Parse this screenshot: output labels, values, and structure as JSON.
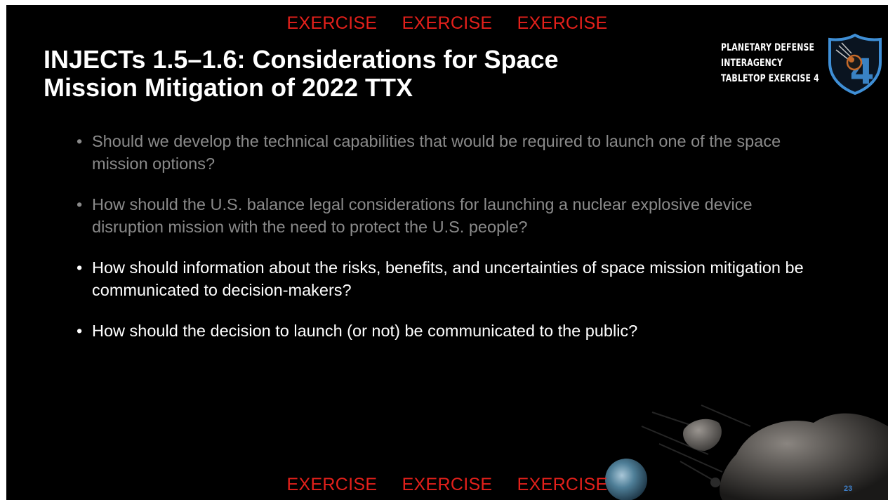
{
  "banner": {
    "words": [
      "EXERCISE",
      "EXERCISE",
      "EXERCISE"
    ]
  },
  "title": {
    "line1": "INJECTs 1.5–1.6: Considerations for Space",
    "line2": "Mission Mitigation of 2022 TTX"
  },
  "logo": {
    "lines": [
      "PLANETARY DEFENSE",
      "INTERAGENCY",
      "TABLETOP EXERCISE 4"
    ],
    "badge_number": "4"
  },
  "bullets": [
    {
      "text": "Should we develop the technical capabilities that would be required to launch one of the space mission options?",
      "state": "dim"
    },
    {
      "text": "How should the U.S. balance legal considerations for launching a nuclear explosive device disruption mission with the need to protect the U.S. people?",
      "state": "dim"
    },
    {
      "text": "How should information about the risks, benefits, and uncertainties of space mission mitigation be communicated to decision-makers?",
      "state": "bright"
    },
    {
      "text": "How should the decision to launch (or not) be communicated to the public?",
      "state": "bright"
    }
  ],
  "page_number": "23",
  "colors": {
    "banner": "#e3201b",
    "background": "#000000",
    "dim_text": "#8a8a8a",
    "logo_blue": "#3f8fd6"
  },
  "decor": {
    "images": [
      "asteroid-image",
      "earth-image",
      "meteor-streak-lines"
    ]
  }
}
